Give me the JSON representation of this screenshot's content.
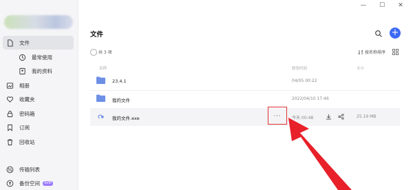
{
  "window": {
    "minimize": "—",
    "maximize": "☐",
    "close": "✕"
  },
  "sidebar": {
    "items": [
      {
        "label": "文件"
      },
      {
        "label": "最常使用"
      },
      {
        "label": "我的资料"
      },
      {
        "label": "相册"
      },
      {
        "label": "收藏夹"
      },
      {
        "label": "密码箱"
      },
      {
        "label": "订阅"
      },
      {
        "label": "回收站"
      },
      {
        "label": "传输列表"
      },
      {
        "label": "备份空间"
      }
    ],
    "vip_badge": "SVIP"
  },
  "main": {
    "title": "文件",
    "add": "+",
    "count": "共 3 项",
    "sort_label": "按名称排序",
    "columns": {
      "name": "名称",
      "modified": "修改时间",
      "size": "大小"
    },
    "files": [
      {
        "name": "23.4.1",
        "time": "04/05 00:22",
        "size": "",
        "icon": "folder-icon"
      },
      {
        "name": "我的文件",
        "time": "2022/04/10 17:46",
        "size": "",
        "icon": "folder-icon"
      },
      {
        "name": "我的文件.exe",
        "time": "今天 00:48",
        "size": "25.19 MB",
        "icon": "exe-file-icon",
        "more": "···"
      }
    ]
  },
  "colors": {
    "accent": "#3c6af5",
    "highlight_box": "#e03030",
    "arrow": "#e8202a",
    "folder": "#6d8fe6"
  }
}
